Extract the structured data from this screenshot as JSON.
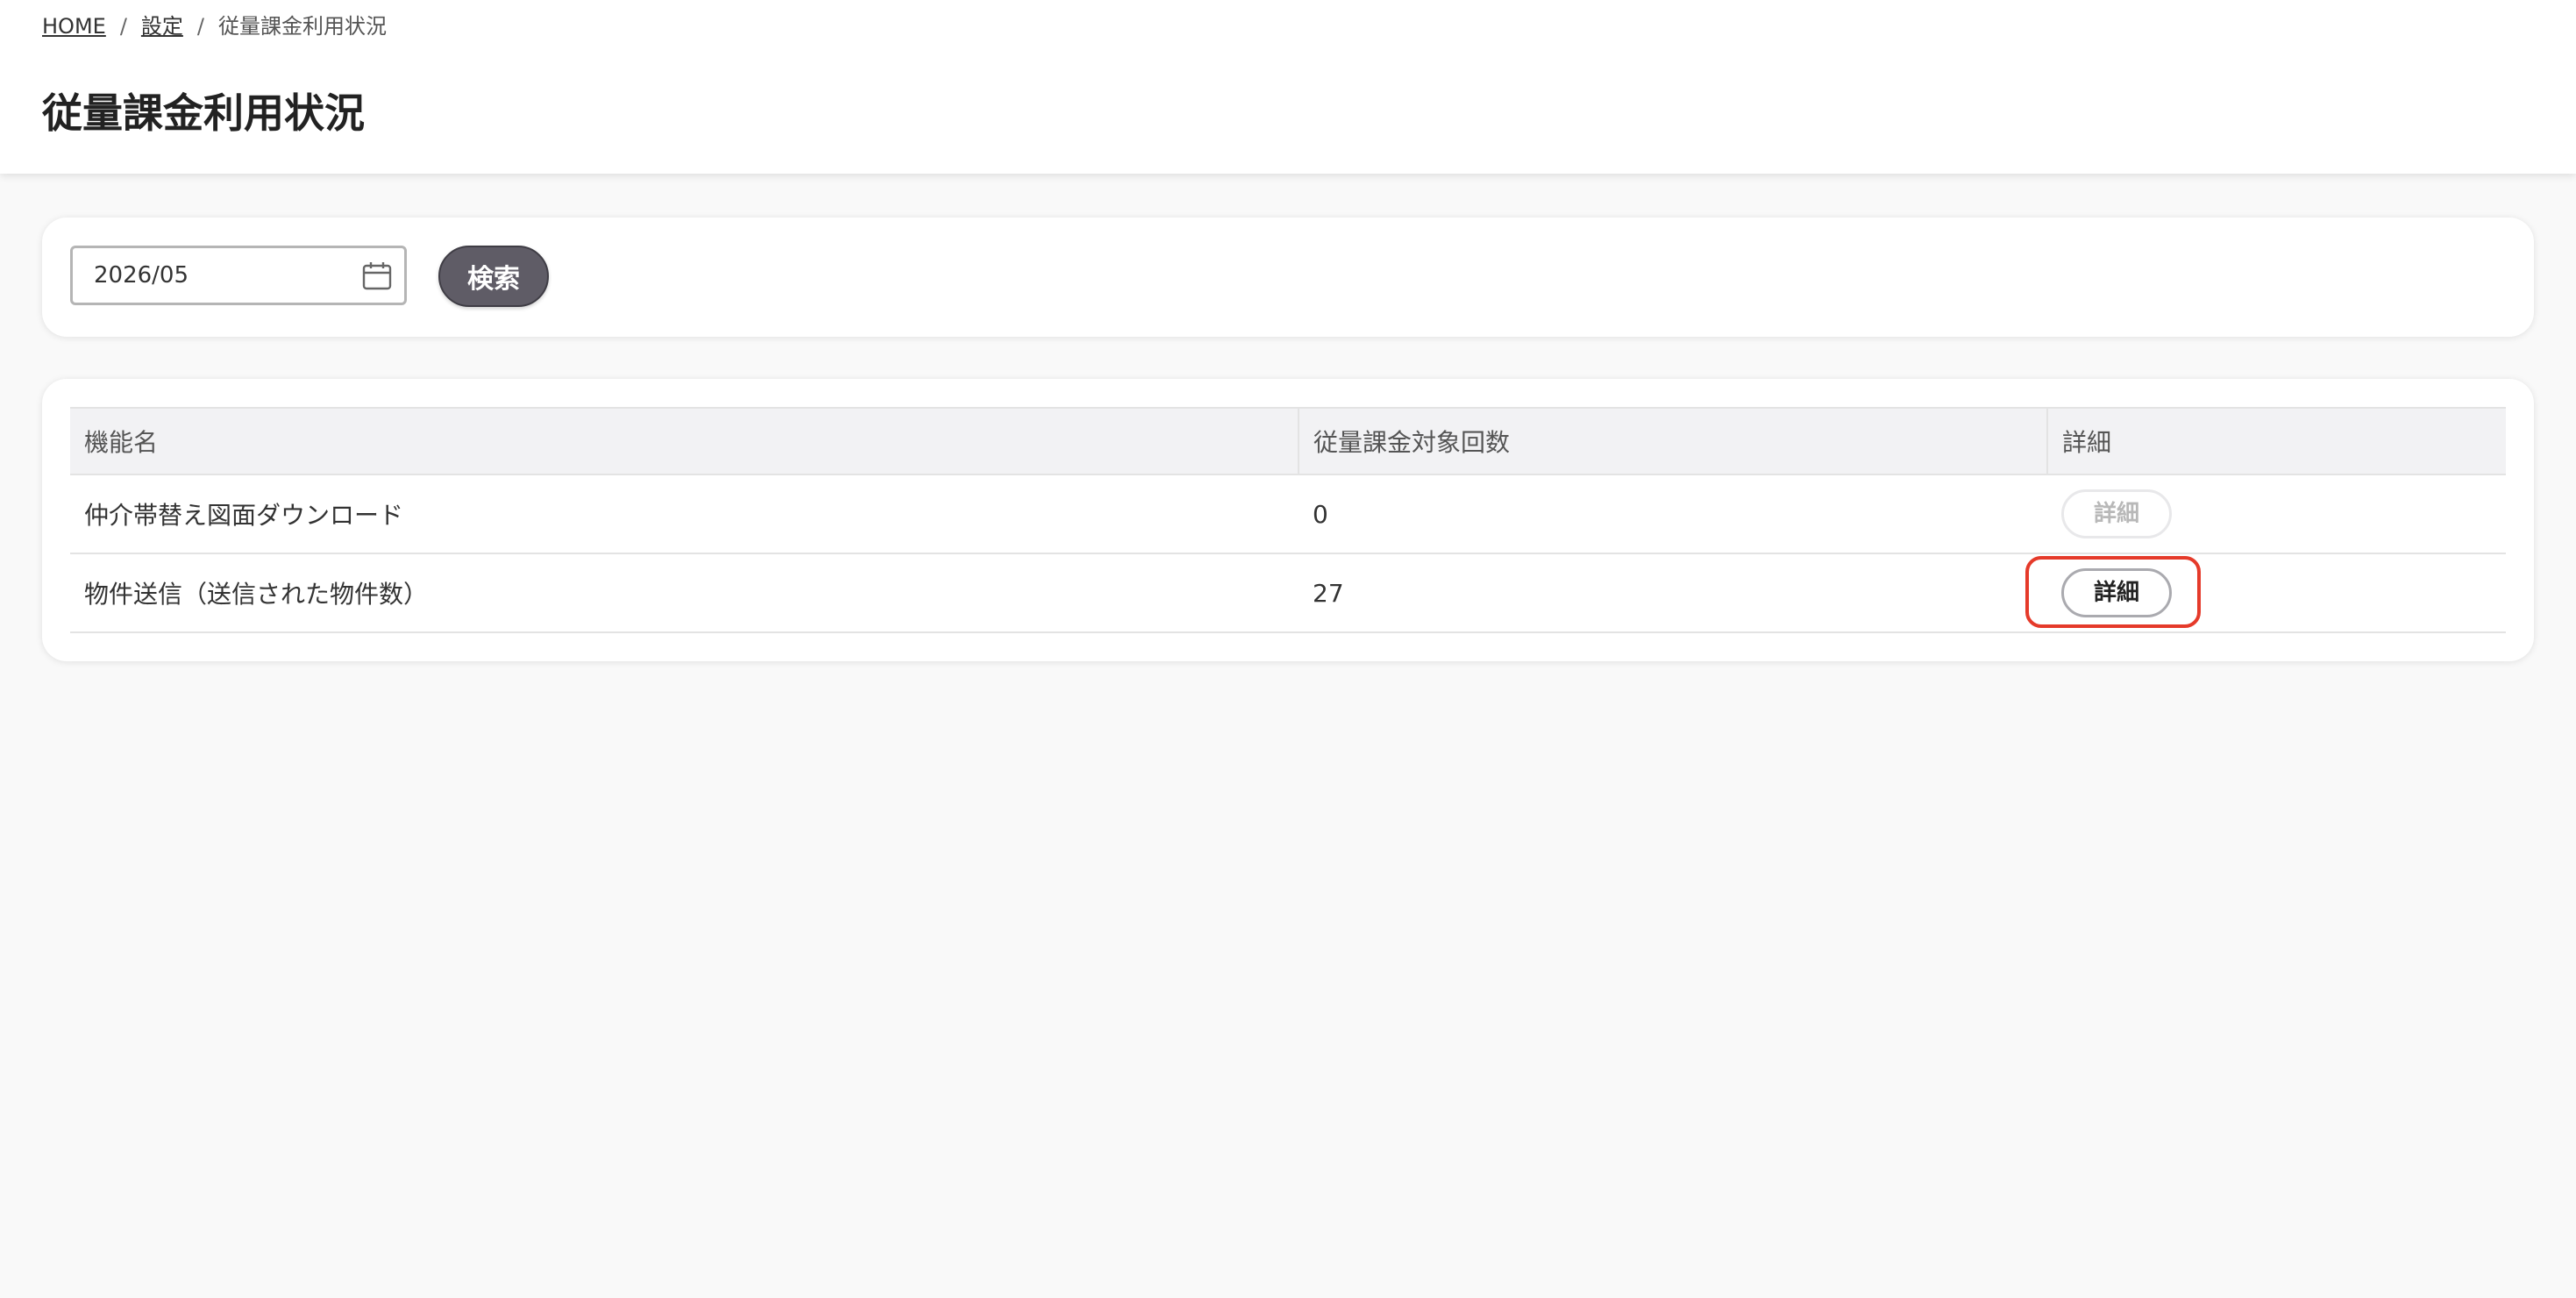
{
  "breadcrumb": {
    "home": "HOME",
    "settings": "設定",
    "separator": "/",
    "current": "従量課金利用状況"
  },
  "page": {
    "title": "従量課金利用状況"
  },
  "search": {
    "month_value": "2026/05",
    "button_label": "検索",
    "calendar_icon": "calendar-icon"
  },
  "table": {
    "headers": {
      "feature": "機能名",
      "count": "従量課金対象回数",
      "detail": "詳細"
    },
    "rows": [
      {
        "feature": "仲介帯替え図面ダウンロード",
        "count": "0",
        "detail_label": "詳細",
        "detail_enabled": false
      },
      {
        "feature": "物件送信（送信された物件数）",
        "count": "27",
        "detail_label": "詳細",
        "detail_enabled": true
      }
    ]
  },
  "colors": {
    "background": "#f9f9f9",
    "search_button": "#5f5c66",
    "highlight": "#e53a2a"
  }
}
